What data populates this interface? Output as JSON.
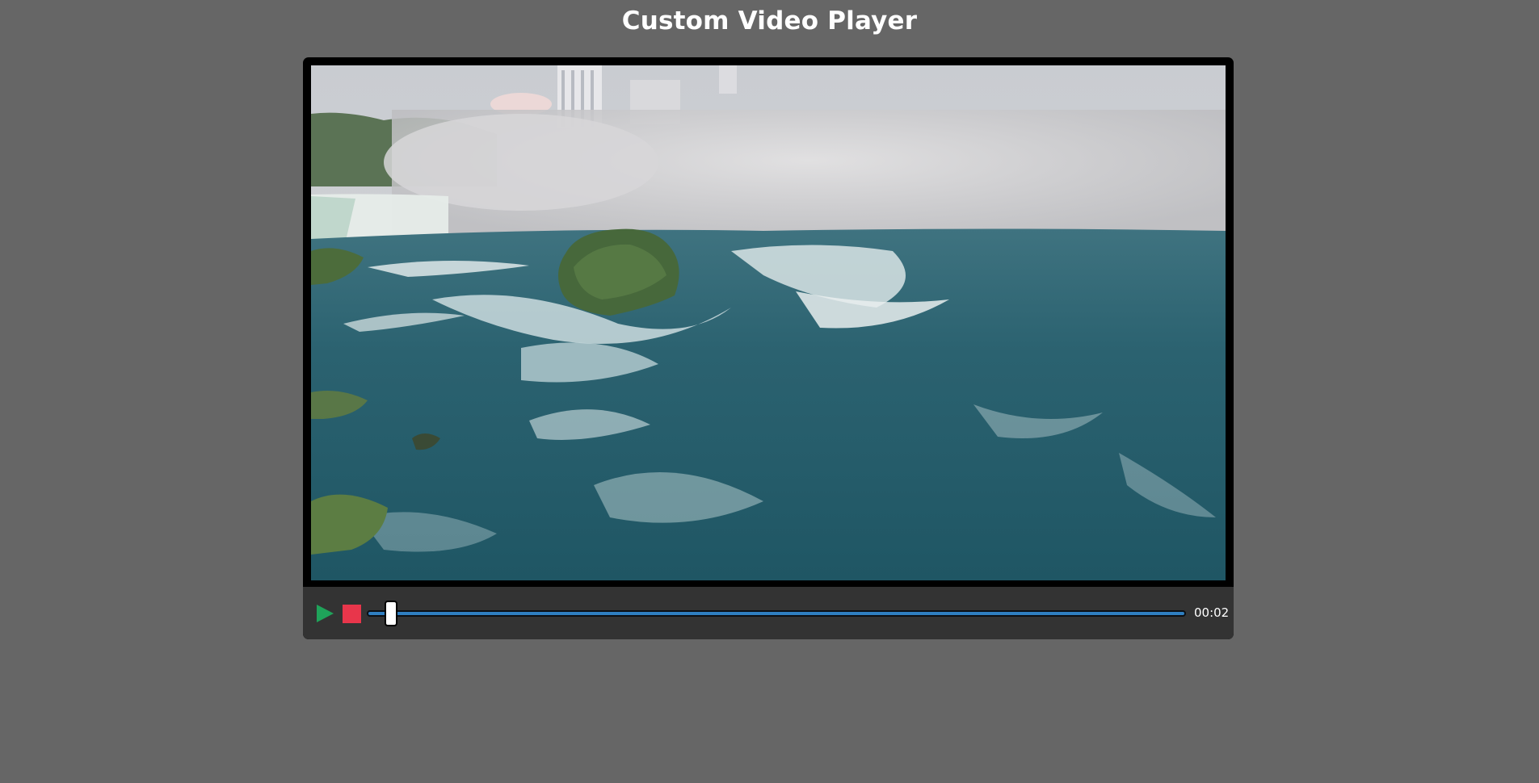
{
  "page": {
    "title": "Custom Video Player"
  },
  "player": {
    "video": {
      "scene": "waterfall-rapids-frame"
    },
    "controls": {
      "play_icon": "play-icon",
      "stop_icon": "stop-icon",
      "play_color": "#1fa35a",
      "stop_color": "#e8364b",
      "progress_color": "#2f7fc1",
      "progress_fraction": 0.02,
      "time": "00:02"
    }
  }
}
